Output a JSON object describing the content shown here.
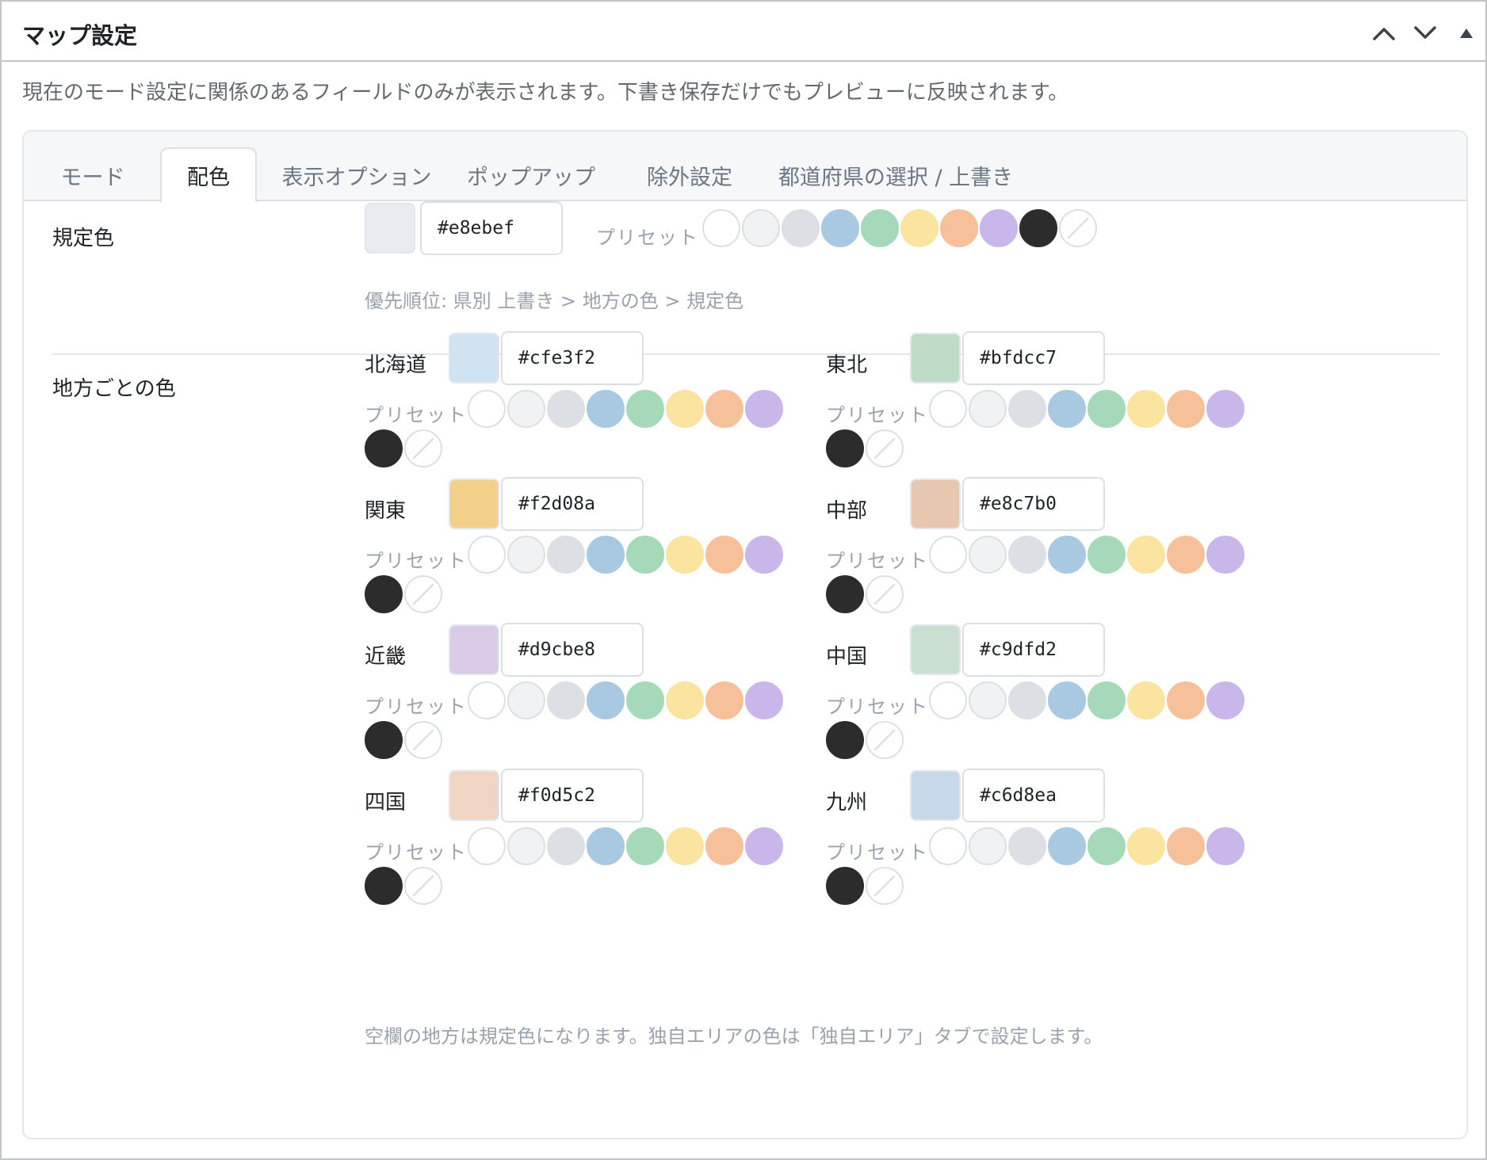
{
  "metabox": {
    "title": "マップ設定",
    "description": "現在のモード設定に関係のあるフィールドのみが表示されます。下書き保存だけでもプレビューに反映されます。"
  },
  "tabs": [
    {
      "label": "モード",
      "active": false
    },
    {
      "label": "配色",
      "active": true
    },
    {
      "label": "表示オプション",
      "active": false
    },
    {
      "label": "ポップアップ",
      "active": false
    },
    {
      "label": "除外設定",
      "active": false
    },
    {
      "label": "都道府県の選択 / 上書き",
      "active": false
    }
  ],
  "preset_label": "プリセット",
  "presets": [
    {
      "name": "white",
      "color": "#ffffff"
    },
    {
      "name": "very-light-gray",
      "color": "#f1f2f4"
    },
    {
      "name": "light-gray",
      "color": "#dcdfe3"
    },
    {
      "name": "blue",
      "color": "#a9c9e3"
    },
    {
      "name": "green",
      "color": "#a6d9b9"
    },
    {
      "name": "yellow",
      "color": "#fbe3a0"
    },
    {
      "name": "orange",
      "color": "#f6c09a"
    },
    {
      "name": "purple",
      "color": "#c9b6ea"
    },
    {
      "name": "black",
      "color": "#2c2c2c"
    },
    {
      "name": "none",
      "color": "none",
      "icon": "slash-icon"
    }
  ],
  "default_color": {
    "label": "規定色",
    "value": "#e8ebef",
    "hint": "優先順位: 県別 上書き > 地方の色 > 規定色"
  },
  "regions_label": "地方ごとの色",
  "regions": [
    {
      "name": "北海道",
      "value": "#cfe3f2"
    },
    {
      "name": "東北",
      "value": "#bfdcc7"
    },
    {
      "name": "関東",
      "value": "#f2d08a"
    },
    {
      "name": "中部",
      "value": "#e8c7b0"
    },
    {
      "name": "近畿",
      "value": "#d9cbe8"
    },
    {
      "name": "中国",
      "value": "#c9dfd2"
    },
    {
      "name": "四国",
      "value": "#f0d5c2"
    },
    {
      "name": "九州",
      "value": "#c6d8ea"
    }
  ],
  "regions_hint": "空欄の地方は規定色になります。独自エリアの色は「独自エリア」タブで設定します。"
}
